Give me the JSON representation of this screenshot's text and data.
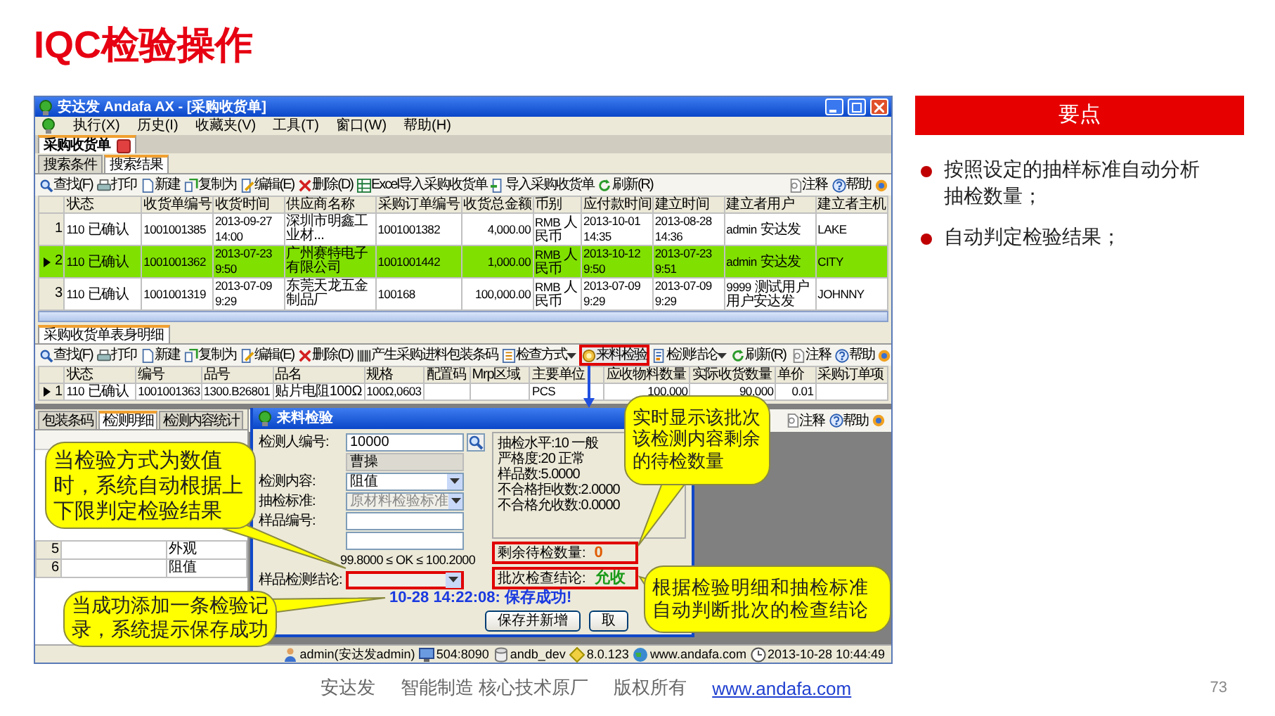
{
  "slide": {
    "title": "IQC检验操作",
    "page_number": "73"
  },
  "app_window": {
    "title": "安达发 Andafa AX - [采购收货单]",
    "menu": [
      "执行(X)",
      "历史(I)",
      "收藏夹(V)",
      "工具(T)",
      "窗口(W)",
      "帮助(H)"
    ],
    "document_tabs": [
      {
        "label": "采购收货单",
        "selected": true
      }
    ],
    "search_tabs": [
      {
        "label": "搜索条件",
        "selected": false
      },
      {
        "label": "搜索结果",
        "selected": true
      }
    ],
    "toolbar": {
      "left": [
        {
          "kind": "search",
          "label": "查找(F)"
        },
        {
          "kind": "print",
          "label": "打印"
        },
        {
          "kind": "new",
          "label": "新建"
        },
        {
          "kind": "copy",
          "label": "复制为"
        },
        {
          "kind": "edit",
          "label": "编辑(E)"
        },
        {
          "kind": "delete",
          "label": "删除(D)"
        },
        {
          "kind": "excel",
          "label": "Excel导入采购收货单"
        },
        {
          "kind": "import",
          "label": "导入采购收货单"
        },
        {
          "kind": "refresh",
          "label": "刷新(R)"
        }
      ],
      "right": [
        {
          "kind": "note",
          "label": "注释"
        },
        {
          "kind": "help",
          "label": "帮助"
        },
        {
          "kind": "settings"
        }
      ]
    },
    "table": {
      "columns": [
        {
          "label": "状态"
        },
        {
          "label": "收货单编号"
        },
        {
          "label": "收货时间"
        },
        {
          "label": "供应商名称"
        },
        {
          "label": "采购订单编号"
        },
        {
          "label": "收货总金额",
          "kind": "number"
        },
        {
          "label": "币别"
        },
        {
          "label": "应付款时间"
        },
        {
          "label": "建立时间"
        },
        {
          "label": "建立者用户"
        },
        {
          "label": "建立者主机"
        }
      ],
      "rows": [
        {
          "number": "1",
          "selected": false,
          "highlighted": false,
          "cells": [
            "110 已确认",
            "1001001385",
            "2013-09-27 14:00",
            "深圳市明鑫工业材...",
            "1001001382",
            "4,000.00",
            "RMB 人民币",
            "2013-10-01 14:35",
            "2013-08-28 14:36",
            "admin 安达发",
            "LAKE"
          ]
        },
        {
          "number": "2",
          "selected": true,
          "highlighted": true,
          "cells": [
            "110 已确认",
            "1001001362",
            "2013-07-23 9:50",
            "广州赛特电子有限公司",
            "1001001442",
            "1,000.00",
            "RMB 人民币",
            "2013-10-12 9:50",
            "2013-07-23 9:51",
            "admin 安达发",
            "CITY"
          ]
        },
        {
          "number": "3",
          "selected": false,
          "highlighted": false,
          "cells": [
            "110 已确认",
            "1001001319",
            "2013-07-09 9:29",
            "东莞天龙五金制品厂",
            "100168",
            "100,000.00",
            "RMB 人民币",
            "2013-07-09 9:29",
            "2013-07-09 9:29",
            "9999 测试用户用户安达发",
            "JOHNNY"
          ]
        }
      ]
    },
    "detail_tabs": [
      {
        "label": "采购收货单表身明细",
        "selected": true
      }
    ],
    "detail_toolbar": {
      "left": [
        {
          "kind": "search",
          "label": "查找(F)",
          "dropdown": false,
          "highlighted": false
        },
        {
          "kind": "print",
          "label": "打印",
          "dropdown": false,
          "highlighted": false
        },
        {
          "kind": "new",
          "label": "新建",
          "dropdown": false,
          "highlighted": false
        },
        {
          "kind": "copy",
          "label": "复制为",
          "dropdown": false,
          "highlighted": false
        },
        {
          "kind": "edit",
          "label": "编辑(E)",
          "dropdown": false,
          "highlighted": false
        },
        {
          "kind": "delete",
          "label": "删除(D)",
          "dropdown": false,
          "highlighted": false
        },
        {
          "kind": "barcode",
          "label": "产生采购进料包装条码",
          "dropdown": false,
          "highlighted": false
        },
        {
          "kind": "check",
          "label": "检查方式",
          "dropdown": true,
          "highlighted": false
        },
        {
          "kind": "inspect",
          "label": "来料检验",
          "dropdown": false,
          "highlighted": true
        },
        {
          "kind": "conclusion",
          "label": "检测结论",
          "dropdown": true,
          "highlighted": false
        },
        {
          "kind": "refresh",
          "label": "刷新(R)",
          "dropdown": false,
          "highlighted": false
        }
      ],
      "right": [
        {
          "kind": "note",
          "label": "注释"
        },
        {
          "kind": "help",
          "label": "帮助"
        },
        {
          "kind": "settings"
        }
      ]
    },
    "detail_table": {
      "columns": [
        {
          "label": "状态"
        },
        {
          "label": "编号"
        },
        {
          "label": "品号"
        },
        {
          "label": "品名"
        },
        {
          "label": "规格"
        },
        {
          "label": "配置码"
        },
        {
          "label": "Mrp区域"
        },
        {
          "label": "主要单位"
        },
        {
          "label": "应收物料数量",
          "kind": "number"
        },
        {
          "label": "实际收货数量",
          "kind": "number"
        },
        {
          "label": "单价",
          "kind": "number"
        },
        {
          "label": "采购订单项"
        }
      ],
      "rows": [
        {
          "number": "1",
          "selected": true,
          "highlighted": false,
          "cells": [
            "110 已确认",
            "1001001363",
            "1300.B26801",
            "贴片电阻100Ω",
            "100Ω,0603",
            null,
            null,
            "PCS",
            "100,000",
            "90,000",
            "0.01",
            null
          ]
        }
      ]
    },
    "inspection_tabs": [
      {
        "label": "包装条码",
        "selected": false
      },
      {
        "label": "检测明细",
        "selected": true
      },
      {
        "label": "检测内容统计",
        "selected": false
      }
    ],
    "inspection_rows": [
      {
        "number": "5",
        "content": "外观"
      },
      {
        "number": "6",
        "content": "阻值"
      }
    ],
    "inspection_toolbar": [
      {
        "kind": "note",
        "label": "注释"
      },
      {
        "kind": "help",
        "label": "帮助"
      },
      {
        "kind": "settings"
      }
    ],
    "status_bar": [
      {
        "kind": "user",
        "text": "admin(安达发admin)"
      },
      {
        "kind": "monitor",
        "text": "504:8090"
      },
      {
        "kind": "database",
        "text": "andb_dev"
      },
      {
        "kind": "bulb",
        "text": "8.0.123"
      },
      {
        "kind": "globe",
        "text": "www.andafa.com"
      },
      {
        "kind": "clock",
        "text": "2013-10-28 10:44:49"
      }
    ]
  },
  "dialog": {
    "title": "来料检验",
    "fields": [
      {
        "kind": "lookup_input",
        "label": "检测人编号:",
        "value": "10000"
      },
      {
        "kind": "display",
        "value": "曹操"
      },
      {
        "kind": "select",
        "label": "检测内容:",
        "value": "阻值",
        "disabled": false,
        "highlighted": false
      },
      {
        "kind": "select",
        "label": "抽检标准:",
        "value": "原材料检验标准",
        "disabled": true,
        "highlighted": false
      },
      {
        "kind": "input",
        "label": "样品编号:"
      },
      {
        "kind": "input"
      },
      {
        "kind": "range",
        "value": "99.8000 ≤ OK ≤ 100.2000"
      },
      {
        "kind": "select",
        "label": "样品检测结论:",
        "disabled": true,
        "highlighted": true
      }
    ],
    "info_lines": [
      "抽检水平:10 一般",
      "严格度:20 正常",
      "样品数:5.0000",
      "不合格拒收数:2.0000",
      "不合格允收数:0.0000"
    ],
    "results": [
      {
        "label": "剩余待检数量:",
        "value": "0",
        "color": "#e05a00",
        "highlighted": true
      },
      {
        "label": "批次检查结论:",
        "value": "允收",
        "color": "#1a9a1a",
        "highlighted": true
      }
    ],
    "message": "10-28 14:22:08: 保存成功!",
    "buttons": [
      "保存并新增",
      "取"
    ]
  },
  "callouts": [
    "当检验方式为数值时，系统自动根据上下限判定检验结果",
    "当成功添加一条检验记录，系统提示保存成功",
    "实时显示该批次该检测内容剩余的待检数量",
    "根据检验明细和抽检标准自动判断批次的检查结论"
  ],
  "key_points": {
    "heading": "要点",
    "items": [
      "按照设定的抽样标准自动分析抽检数量；",
      "自动判定检验结果；"
    ]
  },
  "footer": {
    "items": [
      "安达发",
      "智能制造 核心技术原厂",
      "版权所有"
    ],
    "link": "www.andafa.com"
  }
}
